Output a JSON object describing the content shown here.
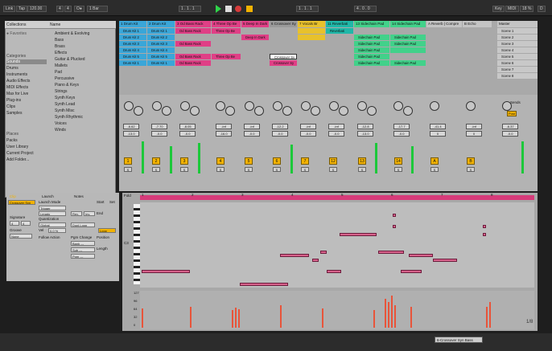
{
  "transport": {
    "link": "Link",
    "tap": "Tap",
    "tempo": "120.00",
    "sig_num": "4",
    "sig_den": "4",
    "metro": "O●",
    "quant": "1 Bar",
    "pos": "1 . 1 . 1",
    "loop_len": "4 . 0 . 0",
    "key": "Key",
    "midi": "MIDI",
    "cpu": "18 %",
    "d": "D"
  },
  "browser": {
    "header_collections": "Collections",
    "header_name": "Name",
    "favorites": "Favorites",
    "categories_label": "Categories",
    "categories": [
      "Sounds",
      "Drums",
      "Instruments",
      "Audio Effects",
      "MIDI Effects",
      "Max for Live",
      "Plug-ins",
      "Clips",
      "Samples"
    ],
    "places_label": "Places",
    "places": [
      "Packs",
      "User Library",
      "Current Project",
      "Add Folder..."
    ],
    "items": [
      "Ambient & Evolving",
      "Bass",
      "Brass",
      "Effects",
      "Guitar & Plucked",
      "Mallets",
      "Pad",
      "Percussive",
      "Piano & Keys",
      "Strings",
      "Synth Keys",
      "Synth Lead",
      "Synth Misc",
      "Synth Rhythmic",
      "Voices",
      "Winds"
    ]
  },
  "tracks": [
    {
      "name": "1 Drum Kit",
      "color": "#3aa6d8"
    },
    {
      "name": "2 Drum Kit",
      "color": "#3aa6d8"
    },
    {
      "name": "3 Od Bass Rack",
      "color": "#e03f86"
    },
    {
      "name": "4 Three Op Be",
      "color": "#e03f86"
    },
    {
      "name": "5 Deep In Dark",
      "color": "#e03f86"
    },
    {
      "name": "6 Crossover Sy",
      "color": "#9a9a9a"
    },
    {
      "name": "7 Vocals Br",
      "color": "#e8c12c"
    },
    {
      "name": "11 Reverbati",
      "color": "#1fb7a8"
    },
    {
      "name": "13 Sidechain Pad",
      "color": "#42d18a"
    },
    {
      "name": "14 Sidechain Pad",
      "color": "#42d18a"
    },
    {
      "name": "A Reverb | Compre",
      "color": "#c4c4c4"
    },
    {
      "name": "B Echo",
      "color": "#c4c4c4"
    }
  ],
  "master": {
    "name": "Master",
    "scenes": [
      "Scene 1",
      "Scene 2",
      "Scene 3",
      "Scene 4",
      "Scene 5",
      "Scene 6",
      "Scene 7",
      "Scene 8"
    ]
  },
  "clips": {
    "drum1": "Drum Kit 1",
    "drum2": "Drum Kit 2",
    "drum3": "Drum Kit 3",
    "drum4": "Drum Kit 4",
    "drum5": "Drum Kit 5",
    "odbass": "Od Bass Rack",
    "threeop": "Three Op Be",
    "deepdark": "Deep In Dark",
    "crossover": "Crossover Sy",
    "reverbati": "Reverbati",
    "sidechain": "Sidechain Pad"
  },
  "mixer": {
    "sends_label": "Sends",
    "vol_values": [
      "-6.62",
      "-7.70",
      "-8.05",
      "-inf",
      "-inf",
      "-12.2",
      "-inf",
      "-inf",
      "-12.8",
      "-17.7",
      "-41.4",
      "-inf",
      "-6.37"
    ],
    "pan_values": [
      "-13.0",
      "-0.0",
      "-0.0",
      "-16.0",
      "-0.0",
      "-0.0",
      "-0.0",
      "-0.0",
      "-13.0",
      "-0.0",
      "0",
      "0",
      "-0.0"
    ],
    "track_numbers": [
      "1",
      "2",
      "3",
      "4",
      "5",
      "6",
      "7",
      "12",
      "13",
      "14",
      "A",
      "B"
    ],
    "post": "Post",
    "solo": "S"
  },
  "clip_detail": {
    "clip_label": "Clip",
    "launch_label": "Launch",
    "notes_label": "Notes",
    "clip_name": "Crossover Syn",
    "launch_mode_label": "Launch Mode",
    "launch_mode": "Trigger",
    "legato": "Legato",
    "quantization_label": "Quantization",
    "quantization": "Global",
    "follow_label": "Follow Action",
    "signature_label": "Signature",
    "sig_num": "4",
    "sig_den": "4",
    "groove_label": "Groove",
    "groove": "None",
    "vel_label": "Vel",
    "vel": "0.0 %",
    "start_label": "Start",
    "end_label": "End",
    "set_label": "Set",
    "rev": "Rev.",
    "inv": "Inv.",
    "dupl": "Dupl.Loop",
    "loop": "Loop",
    "position_label": "Position",
    "length_label": "Length",
    "pgm_label": "Pgm Change",
    "bank": "Bank ---",
    "sub": "Sub ---",
    "pgm": "Pgm ---",
    "fold": "Fold",
    "zoom_label": "1/8",
    "c3": "C3",
    "vel_ticks": [
      "127",
      "96",
      "64",
      "32",
      "0"
    ]
  },
  "ruler": [
    "1",
    "2",
    "3",
    "4",
    "5",
    "6",
    "7",
    "8"
  ],
  "status": {
    "track": "6-Crossover Syn Bass"
  }
}
